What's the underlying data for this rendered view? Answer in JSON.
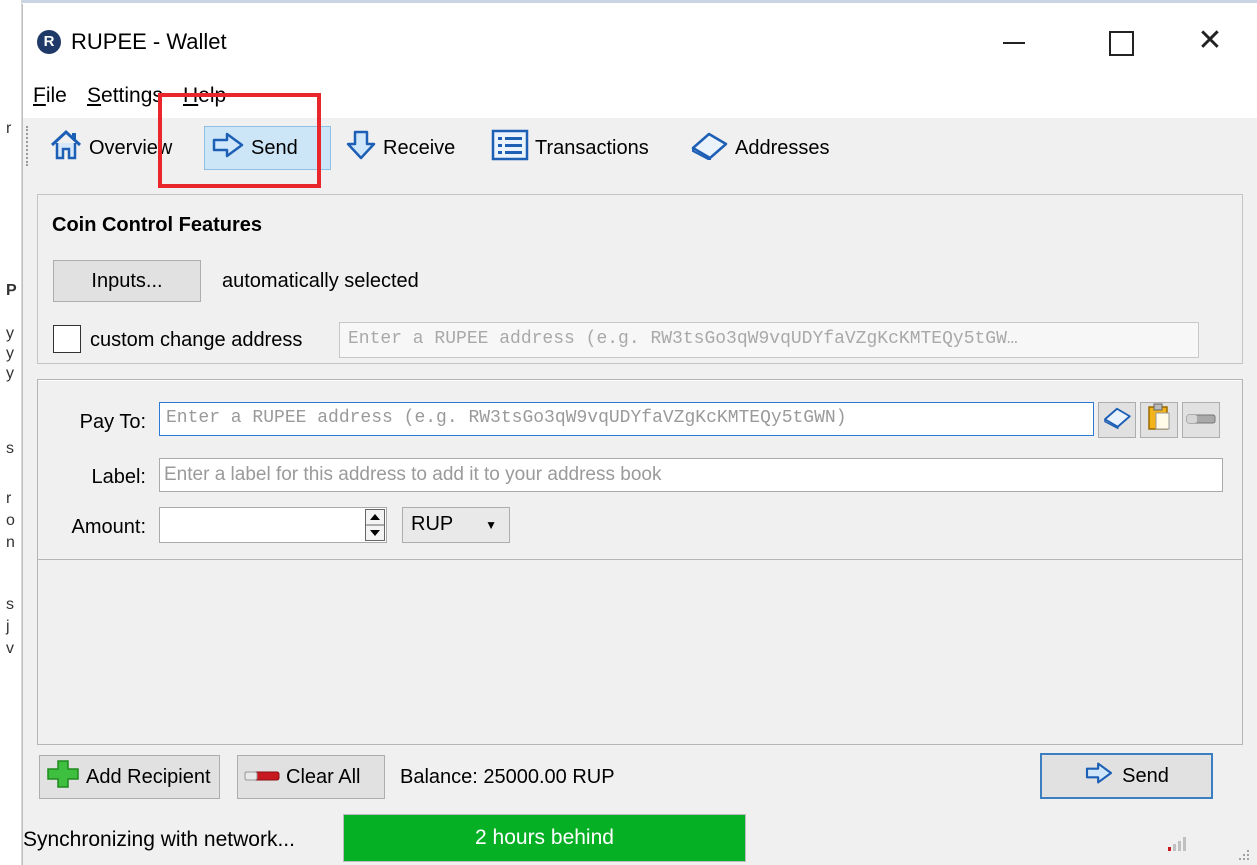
{
  "window": {
    "title": "RUPEE - Wallet",
    "icon_letter": "R"
  },
  "menu": [
    {
      "label": "File",
      "mnemonic": "F",
      "rest": "ile"
    },
    {
      "label": "Settings",
      "mnemonic": "S",
      "rest": "ettings"
    },
    {
      "label": "Help",
      "mnemonic": "H",
      "rest": "elp"
    }
  ],
  "toolbar": {
    "overview": "Overview",
    "send": "Send",
    "receive": "Receive",
    "transactions": "Transactions",
    "addresses": "Addresses"
  },
  "coin_control": {
    "title": "Coin Control Features",
    "inputs_button": "Inputs...",
    "inputs_status": "automatically selected",
    "custom_change_label": "custom change address",
    "custom_change_placeholder": "Enter a RUPEE address (e.g. RW3tsGo3qW9vqUDYfaVZgKcKMTEQy5tGW…"
  },
  "recipient": {
    "pay_to_label": "Pay To:",
    "pay_to_placeholder": "Enter a RUPEE address (e.g. RW3tsGo3qW9vqUDYfaVZgKcKMTEQy5tGWN)",
    "label_label": "Label:",
    "label_placeholder": "Enter a label for this address to add it to your address book",
    "amount_label": "Amount:",
    "amount_value": "",
    "unit": "RUP"
  },
  "actions": {
    "add_recipient": "Add Recipient",
    "clear_all": "Clear All",
    "balance": "Balance: 25000.00 RUP",
    "send": "Send"
  },
  "status": {
    "sync_text": "Synchronizing with network...",
    "progress_text": "2 hours behind",
    "progress_fraction": 1.0
  },
  "colors": {
    "highlight": "#e8262c",
    "progress": "#06b025",
    "focus_border": "#2a7ad6"
  }
}
